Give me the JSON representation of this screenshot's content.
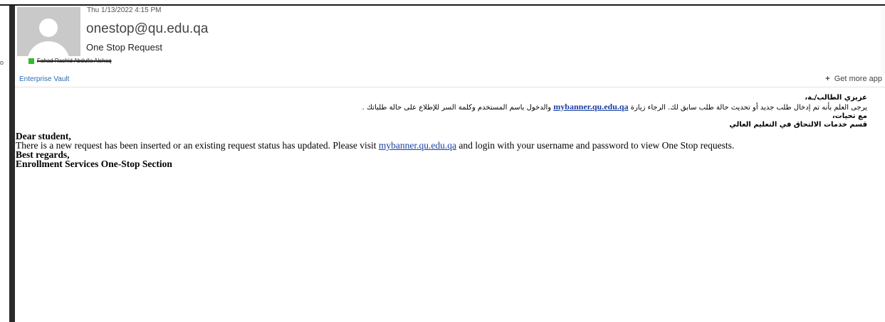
{
  "header": {
    "timestamp": "Thu 1/13/2022 4:15 PM",
    "sender": "onestop@qu.edu.qa",
    "subject": "One Stop Request",
    "to_label": "o",
    "recipient": "Fahad Rashid Abdulla Alshaq"
  },
  "addin_bar": {
    "enterprise_vault": "Enterprise Vault",
    "get_more_plus": "+",
    "get_more": "Get more app"
  },
  "body": {
    "arabic": {
      "greeting": "عزيزي الطالب/ـة،",
      "line_part1": "يرجى العلم بأنه تم إدخال طلب جديد أو تحديث حالة طلب سابق لك. الرجاء زيارة ",
      "link": "mybanner.qu.edu.qa",
      "line_part2": " والدخول باسم المستخدم وكلمة السر للإطلاع على حالة طلباتك .",
      "regards": "مع تحيات،",
      "section": "قسم خدمات الالتحاق في التعليم العالي"
    },
    "english": {
      "greeting": "Dear student,",
      "line_part1": "There is a new request has been inserted or an existing request status has updated. Please visit ",
      "link": "mybanner.qu.edu.qa",
      "line_part2": " and login with your username and password to view One Stop requests.",
      "regards": "Best regards,",
      "section": "Enrollment Services One-Stop Section"
    }
  },
  "colors": {
    "link": "#1a3fa0",
    "presence": "#2dbd2d",
    "addin_link": "#2b6cb0",
    "avatar_bg": "#c9c9c9"
  },
  "icons": {
    "avatar": "default-person-avatar",
    "presence": "presence-available-indicator"
  }
}
